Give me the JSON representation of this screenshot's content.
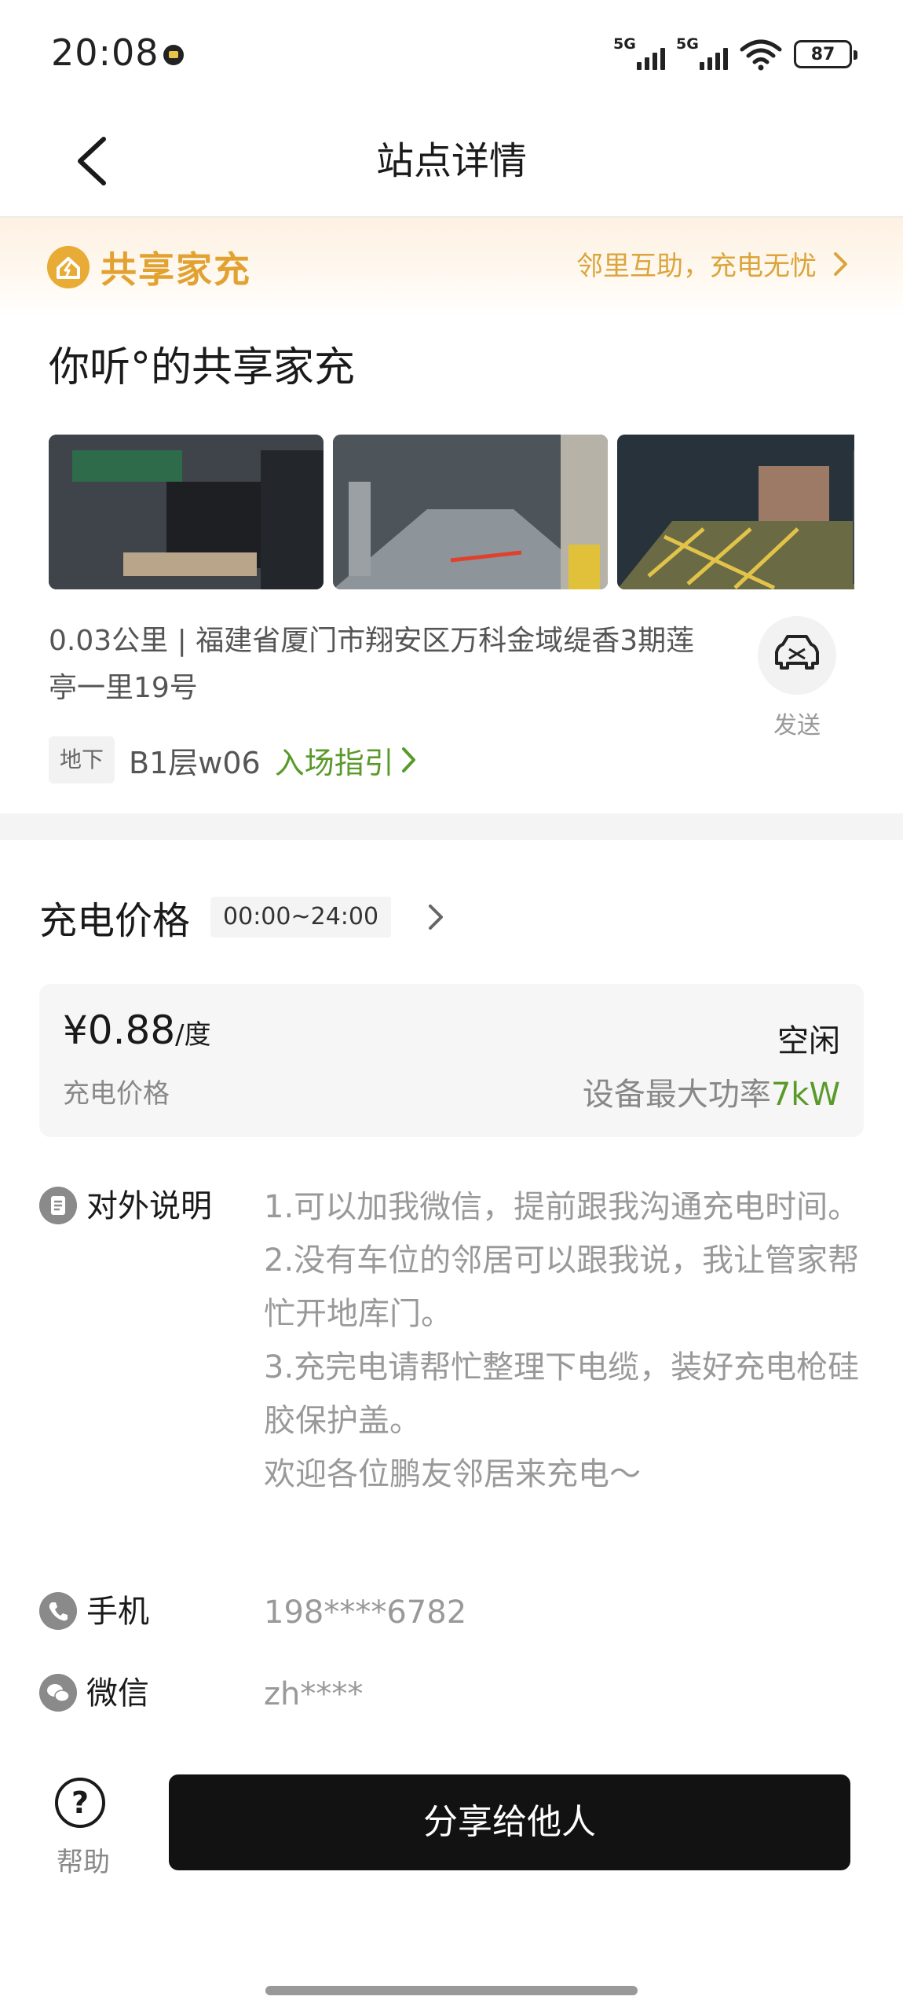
{
  "status_bar": {
    "time": "20:08",
    "network_1": "5G",
    "network_2": "5G",
    "battery": "87"
  },
  "nav": {
    "title": "站点详情",
    "back_icon": "chevron-left-icon"
  },
  "banner": {
    "brand": "共享家充",
    "slogan": "邻里互助，充电无忧",
    "accent": "#e2a232"
  },
  "station": {
    "name": "你听°的共享家充",
    "distance": "0.03公里",
    "address": "福建省厦门市翔安区万科金域缇香3期莲亭一里19号",
    "send_label": "发送",
    "floor_tag": "地下",
    "floor": "B1层w06",
    "guide_label": "入场指引"
  },
  "price": {
    "title": "充电价格",
    "time_range": "00:00~24:00",
    "value": "¥0.88",
    "unit": "/度",
    "label": "充电价格",
    "status": "空闲",
    "power_label": "设备最大功率",
    "power_value": "7kW"
  },
  "notice": {
    "label": "对外说明",
    "lines": [
      "1.可以加我微信，提前跟我沟通充电时间。",
      "2.没有车位的邻居可以跟我说，我让管家帮忙开地库门。",
      "3.充完电请帮忙整理下电缆，装好充电枪硅胶保护盖。",
      "欢迎各位鹏友邻居来充电～"
    ]
  },
  "contact": {
    "phone_label": "手机",
    "phone": "198****6782",
    "wechat_label": "微信",
    "wechat": "zh****"
  },
  "bottom": {
    "help_label": "帮助",
    "share_label": "分享给他人"
  },
  "colors": {
    "green": "#5a9a2a",
    "button": "#121212"
  }
}
